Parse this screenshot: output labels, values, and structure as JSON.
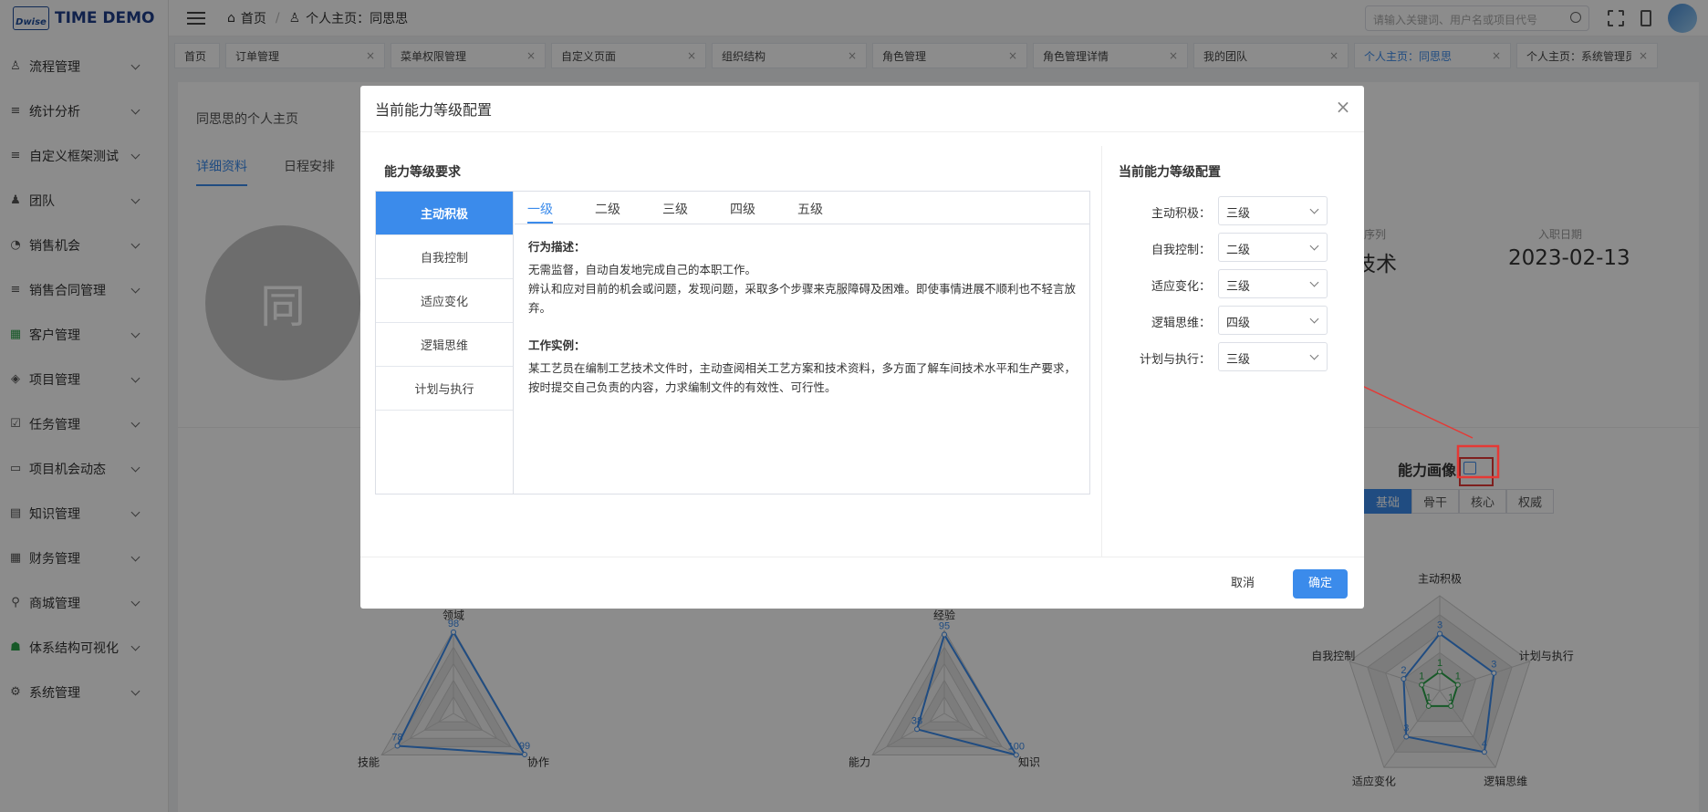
{
  "brand": {
    "logo": "Dwise",
    "title": "TIME DEMO"
  },
  "sidebar": {
    "items": [
      {
        "icon": "user-icon",
        "label": "流程管理"
      },
      {
        "icon": "list-icon",
        "label": "统计分析"
      },
      {
        "icon": "list-icon",
        "label": "自定义框架测试"
      },
      {
        "icon": "team-icon",
        "label": "团队"
      },
      {
        "icon": "chart-icon",
        "label": "销售机会"
      },
      {
        "icon": "list-icon",
        "label": "销售合同管理"
      },
      {
        "icon": "customer-icon",
        "label": "客户管理"
      },
      {
        "icon": "layers-icon",
        "label": "项目管理"
      },
      {
        "icon": "task-icon",
        "label": "任务管理"
      },
      {
        "icon": "calendar-icon",
        "label": "项目机会动态"
      },
      {
        "icon": "book-icon",
        "label": "知识管理"
      },
      {
        "icon": "table-icon",
        "label": "财务管理"
      },
      {
        "icon": "cart-icon",
        "label": "商城管理"
      },
      {
        "icon": "people-icon",
        "label": "体系结构可视化"
      },
      {
        "icon": "gear-icon",
        "label": "系统管理"
      }
    ]
  },
  "header": {
    "crumb_home": "首页",
    "crumb_current": "个人主页：同思思",
    "search_placeholder": "请输入关键词、用户名或项目代号"
  },
  "tabs": [
    {
      "label": "首页",
      "closable": false
    },
    {
      "label": "订单管理",
      "closable": true
    },
    {
      "label": "菜单权限管理",
      "closable": true
    },
    {
      "label": "自定义页面",
      "closable": true
    },
    {
      "label": "组织结构",
      "closable": true
    },
    {
      "label": "角色管理",
      "closable": true
    },
    {
      "label": "角色管理详情",
      "closable": true
    },
    {
      "label": "我的团队",
      "closable": true
    },
    {
      "label": "个人主页：同思思",
      "closable": true,
      "active": true
    },
    {
      "label": "个人主页：系统管理员",
      "closable": true
    }
  ],
  "page": {
    "title": "同思思的个人主页",
    "subtabs": [
      "详细资料",
      "日程安排"
    ],
    "avatar_char": "同",
    "info": [
      {
        "label": "序列",
        "value": "技术"
      },
      {
        "label": "入职日期",
        "value": "2023-02-13"
      }
    ],
    "portrait_title": "能力画像",
    "segments": [
      "基础",
      "骨干",
      "核心",
      "权威"
    ]
  },
  "modal": {
    "title": "当前能力等级配置",
    "left_title": "能力等级要求",
    "categories": [
      "主动积极",
      "自我控制",
      "适应变化",
      "逻辑思维",
      "计划与执行"
    ],
    "levels": [
      "一级",
      "二级",
      "三级",
      "四级",
      "五级"
    ],
    "behavior_heading": "行为描述：",
    "behavior_lines": [
      "无需监督，自动自发地完成自己的本职工作。",
      "辨认和应对目前的机会或问题，发现问题，采取多个步骤来克服障碍及困难。即使事情进展不顺利也不轻言放弃。"
    ],
    "example_heading": "工作实例：",
    "example_lines": [
      "某工艺员在编制工艺技术文件时，主动查阅相关工艺方案和技术资料，多方面了解车间技术水平和生产要求，按时提交自己负责的内容，力求编制文件的有效性、可行性。"
    ],
    "right_title": "当前能力等级配置",
    "config": [
      {
        "label": "主动积极：",
        "value": "三级"
      },
      {
        "label": "自我控制：",
        "value": "二级"
      },
      {
        "label": "适应变化：",
        "value": "三级"
      },
      {
        "label": "逻辑思维：",
        "value": "四级"
      },
      {
        "label": "计划与执行：",
        "value": "三级"
      }
    ],
    "cancel": "取消",
    "ok": "确定"
  },
  "chart_data": [
    {
      "type": "radar",
      "axes": [
        "领域",
        "协作",
        "技能"
      ],
      "series": [
        {
          "values": [
            98,
            99,
            78
          ]
        }
      ],
      "max": 100
    },
    {
      "type": "radar",
      "axes": [
        "经验",
        "知识",
        "能力"
      ],
      "series": [
        {
          "values": [
            95,
            100,
            38
          ]
        }
      ],
      "max": 100
    },
    {
      "type": "radar",
      "axes": [
        "主动积极",
        "计划与执行",
        "逻辑思维",
        "适应变化",
        "自我控制"
      ],
      "series": [
        {
          "values": [
            3,
            3,
            4,
            3,
            2
          ],
          "color": "#3b8beb"
        },
        {
          "values": [
            1,
            1,
            1,
            1,
            1
          ],
          "color": "#2aa34a"
        }
      ],
      "max": 5
    }
  ]
}
